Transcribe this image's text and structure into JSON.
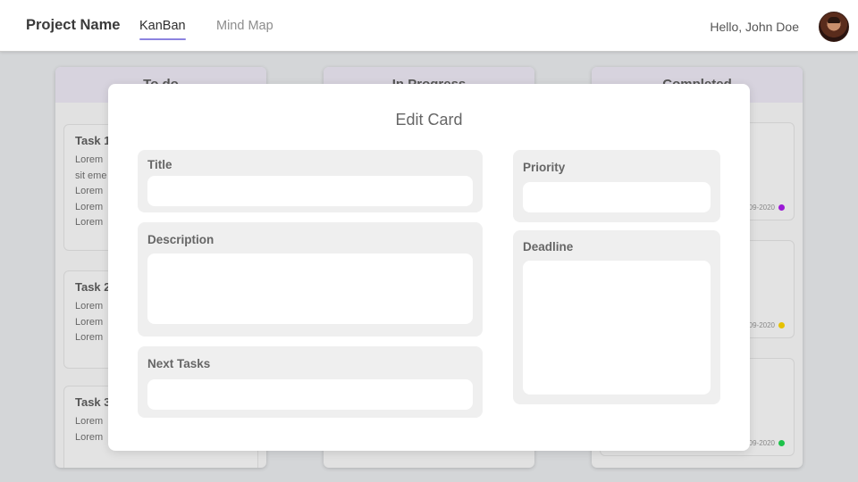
{
  "header": {
    "project_name": "Project Name",
    "tabs": [
      {
        "label": "KanBan",
        "active": true
      },
      {
        "label": "Mind Map",
        "active": false
      }
    ],
    "greeting": "Hello, John Doe",
    "accent_color": "#8c83e0"
  },
  "board": {
    "columns": [
      {
        "title": "To do",
        "cards": [
          {
            "title": "Task 1",
            "desc_lines": [
              "Lorem",
              "sit eme",
              "Lorem",
              "Lorem",
              "Lorem"
            ]
          },
          {
            "title": "Task 2",
            "desc_lines": [
              "Lorem",
              "Lorem",
              "Lorem"
            ]
          },
          {
            "title": "Task 3",
            "desc_lines": [
              "Lorem",
              "Lorem"
            ]
          }
        ]
      },
      {
        "title": "In Progress",
        "cards": []
      },
      {
        "title": "Completed",
        "cards": [
          {
            "date": "09-2020",
            "dot_color": "#9b19d6"
          },
          {
            "date": "09-2020",
            "dot_color": "#e6c100"
          },
          {
            "date": "09-2020",
            "dot_color": "#1ec24a"
          }
        ]
      }
    ]
  },
  "modal": {
    "title": "Edit Card",
    "fields": {
      "title": {
        "label": "Title",
        "value": ""
      },
      "description": {
        "label": "Description",
        "value": ""
      },
      "next_tasks": {
        "label": "Next Tasks",
        "value": ""
      },
      "priority": {
        "label": "Priority",
        "value": ""
      },
      "deadline": {
        "label": "Deadline",
        "value": ""
      }
    }
  }
}
